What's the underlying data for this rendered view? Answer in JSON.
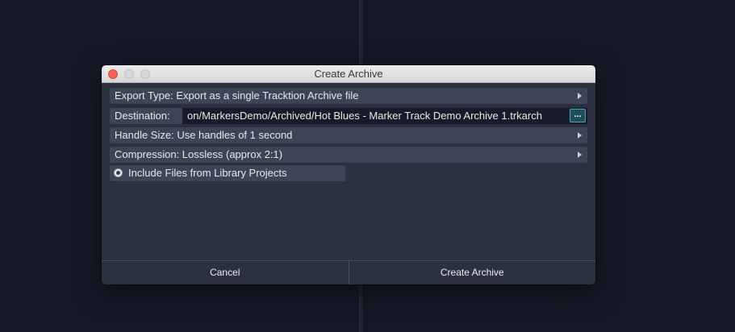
{
  "dialog": {
    "title": "Create Archive"
  },
  "rows": {
    "export_type": "Export Type: Export as a single Tracktion Archive file",
    "destination_label": "Destination:",
    "destination_path": "on/MarkersDemo/Archived/Hot Blues - Marker Track Demo Archive 1.trkarch",
    "browse_label": "...",
    "handle_size": "Handle Size: Use handles of 1 second",
    "compression": "Compression: Lossless (approx 2:1)"
  },
  "options": {
    "include_library": "Include Files from Library Projects"
  },
  "footer": {
    "cancel_label": "Cancel",
    "create_label": "Create Archive"
  },
  "colors": {
    "background": "#151926",
    "dialog": "#2b3141",
    "row": "#3d4455",
    "accent": "#4fa3b5"
  }
}
